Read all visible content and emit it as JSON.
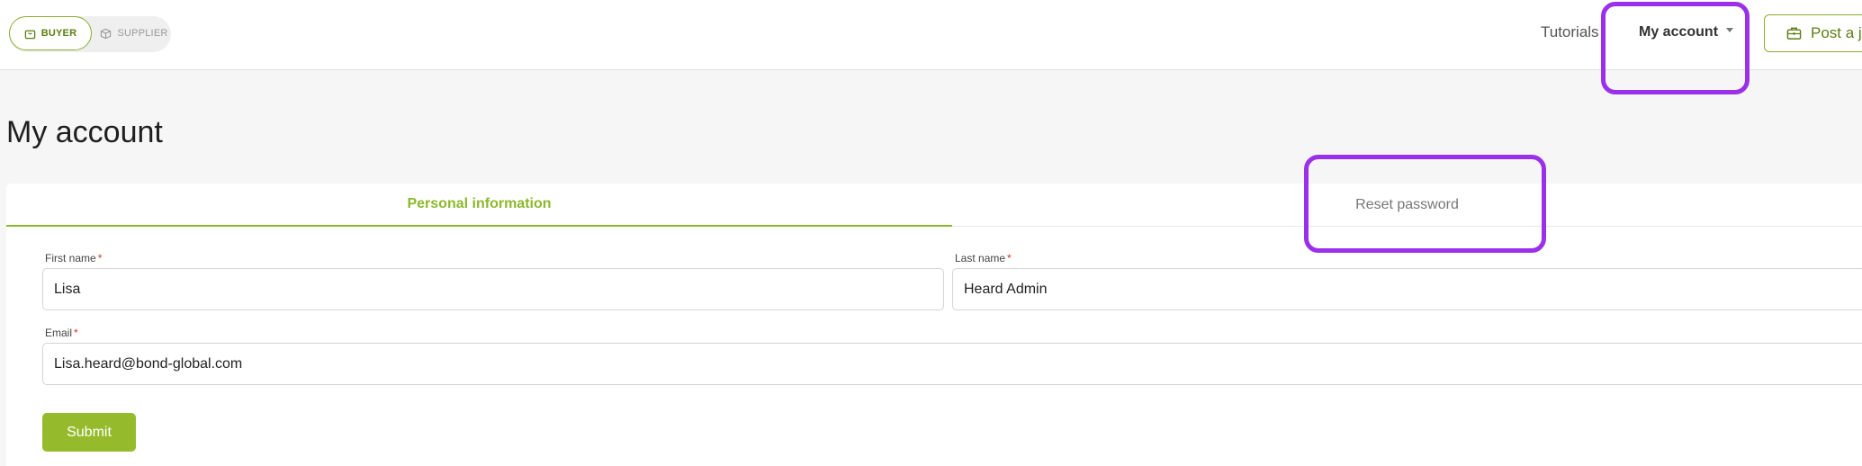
{
  "header": {
    "roles": {
      "buyer_label": "BUYER",
      "supplier_label": "SUPPLIER"
    },
    "nav": {
      "tutorials": "Tutorials",
      "my_account": "My account"
    },
    "post_button": "Post a j"
  },
  "page": {
    "title": "My account"
  },
  "tabs": {
    "personal": "Personal information",
    "reset": "Reset password"
  },
  "form": {
    "first_name": {
      "label": "First name",
      "value": "Lisa"
    },
    "last_name": {
      "label": "Last name",
      "value": "Heard Admin"
    },
    "email": {
      "label": "Email",
      "value": "Lisa.heard@bond-global.com"
    },
    "required_mark": "*",
    "submit_label": "Submit"
  },
  "colors": {
    "accent": "#8cb82c",
    "highlight": "#9b30ea"
  },
  "icons": {
    "buyer": "shopping-bag-icon",
    "supplier": "box-icon",
    "post": "briefcase-icon"
  }
}
